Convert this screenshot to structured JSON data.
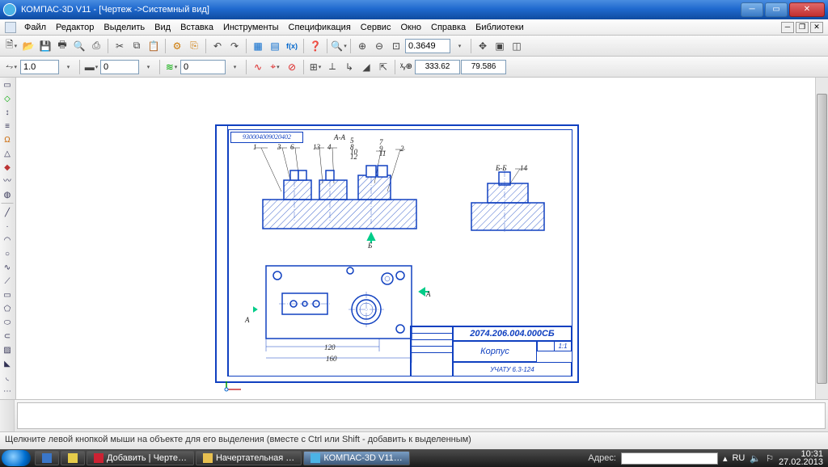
{
  "title": "КОМПАС-3D V11 - [Чертеж ->Системный вид]",
  "menu": [
    "Файл",
    "Редактор",
    "Выделить",
    "Вид",
    "Вставка",
    "Инструменты",
    "Спецификация",
    "Сервис",
    "Окно",
    "Справка",
    "Библиотеки"
  ],
  "toolbar1": {
    "zoom": "0.3649"
  },
  "toolbar2": {
    "step": "1.0",
    "style": "0",
    "layer": "0",
    "coord_x": "333.62",
    "coord_y": "79.586"
  },
  "drawing": {
    "top_stamp": "930004009020402",
    "section_aa": "А-А",
    "section_bb": "Б-Б",
    "section_b": "Б",
    "section_a": "А",
    "dim_120": "120",
    "dim_160": "160",
    "tb_code": "2074.206.004.000СБ",
    "tb_name": "Корпус",
    "tb_scale": "1:1",
    "tb_sheet": "УЧАТУ  6.3-124",
    "leaders": [
      "1",
      "3",
      "6",
      "13",
      "4",
      "5",
      "8",
      "10",
      "12",
      "7",
      "9",
      "11",
      "2",
      "14"
    ]
  },
  "status": "Щелкните левой кнопкой мыши на объекте для его выделения (вместе с Ctrl или Shift - добавить к выделенным)",
  "taskbar": {
    "items": [
      "Добавить | Черте…",
      "Начертательная …",
      "КОМПАС-3D V11…"
    ],
    "addr_label": "Адрес:",
    "lang": "RU",
    "time": "10:31",
    "date": "27.02.2013"
  }
}
